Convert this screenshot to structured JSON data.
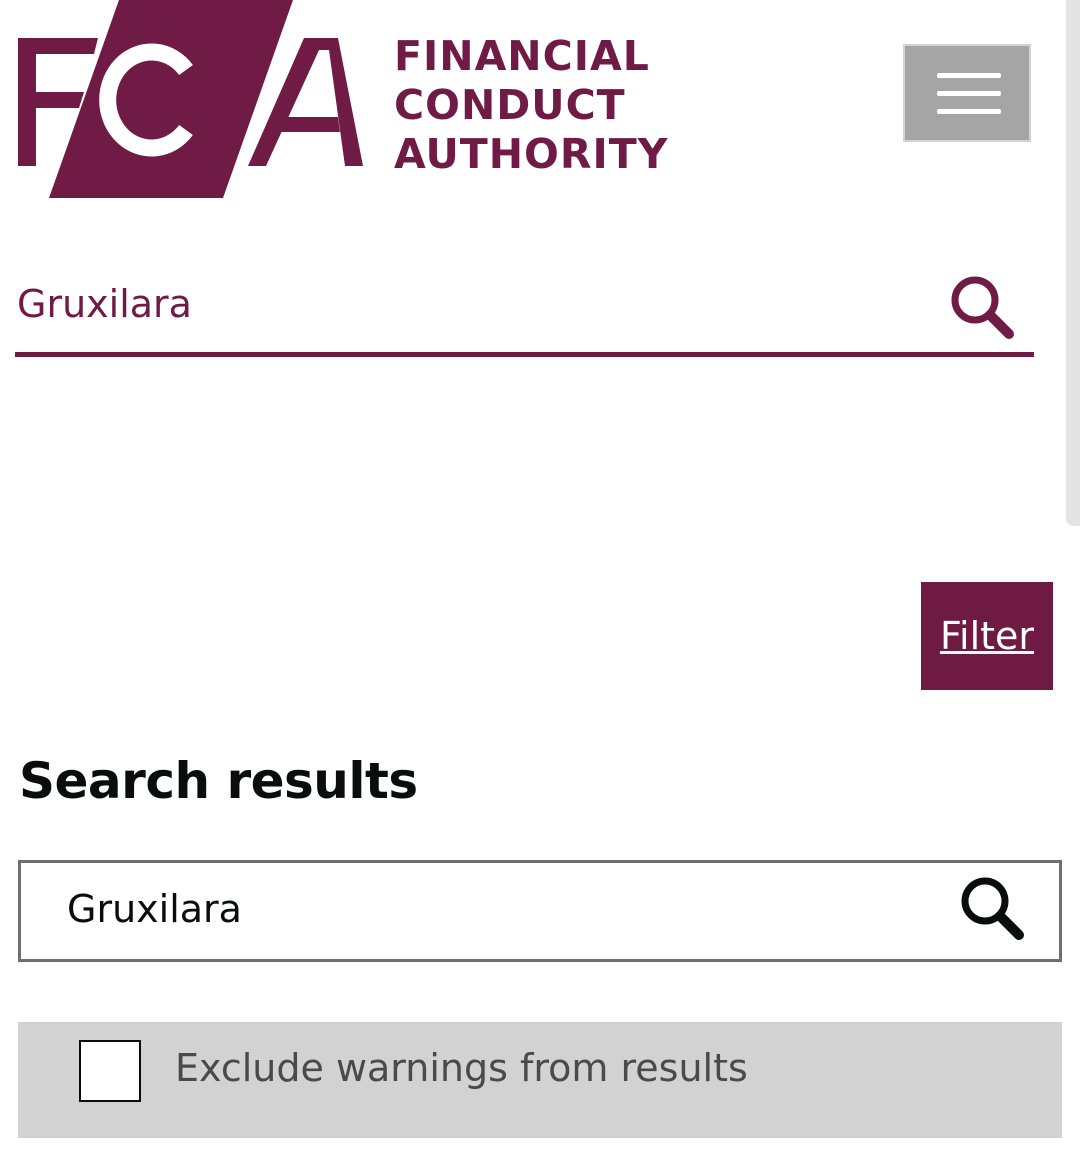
{
  "colors": {
    "brand": "#701b45",
    "menu_bg": "#a5a5a5",
    "filter_bg": "#6e1a43",
    "exclude_bg": "#d2d2d3",
    "text_dark": "#0b0c0c"
  },
  "logo": {
    "monogram": "FCA",
    "words": [
      "FINANCIAL",
      "CONDUCT",
      "AUTHORITY"
    ]
  },
  "header": {
    "menu_icon": "hamburger-menu-icon",
    "search_value": "Gruxilara",
    "search_icon": "search-icon"
  },
  "filter": {
    "label": "Filter"
  },
  "results": {
    "title": "Search results",
    "search_value": "Gruxilara",
    "search_icon": "search-icon",
    "exclude_label": "Exclude warnings from results",
    "exclude_checked": false
  }
}
